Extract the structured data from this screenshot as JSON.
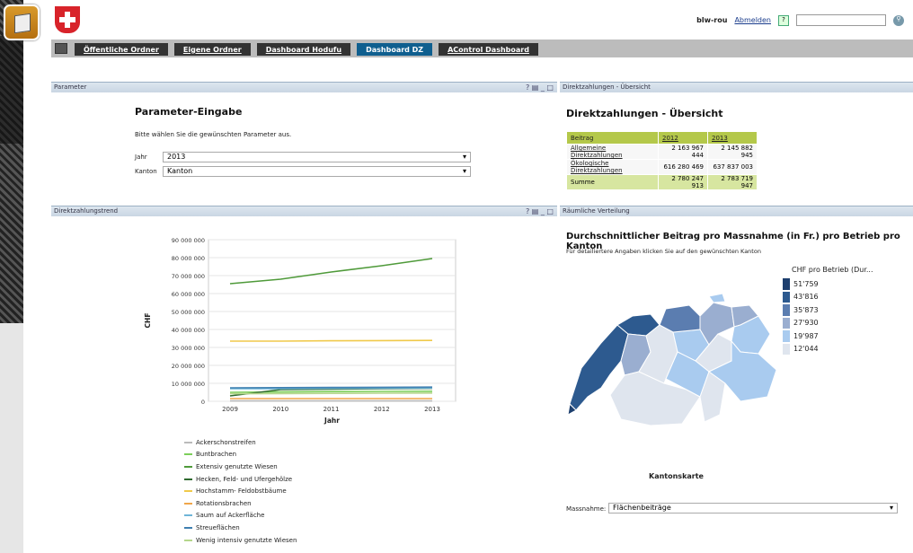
{
  "user": {
    "name": "blw-rou",
    "logout": "Abmelden"
  },
  "tabs": [
    {
      "label": "Öffentliche Ordner"
    },
    {
      "label": "Eigene Ordner"
    },
    {
      "label": "Dashboard Hodufu"
    },
    {
      "label": "Dashboard DZ",
      "active": true
    },
    {
      "label": "AControl Dashboard"
    }
  ],
  "parameter": {
    "header": "Parameter",
    "title": "Parameter-Eingabe",
    "instruction": "Bitte wählen Sie die gewünschten Parameter aus.",
    "jahr_label": "Jahr",
    "jahr_value": "2013",
    "kanton_label": "Kanton",
    "kanton_value": "Kanton"
  },
  "direkt": {
    "header": "Direktzahlungen - Übersicht",
    "title": "Direktzahlungen - Übersicht",
    "table": {
      "headers": [
        "Beitrag",
        "2012",
        "2013"
      ],
      "rows": [
        [
          "Allgemeine Direktzahlungen",
          "2 163 967 444",
          "2 145 882 945"
        ],
        [
          "Ökologische Direktzahlungen",
          "616 280 469",
          "637 837 003"
        ]
      ],
      "sum": [
        "Summe",
        "2 780 247 913",
        "2 783 719 947"
      ]
    }
  },
  "trend": {
    "header": "Direktzahlungstrend"
  },
  "chart_data": {
    "type": "line",
    "ylabel": "CHF",
    "xlabel": "Jahr",
    "x": [
      "2009",
      "2010",
      "2011",
      "2012",
      "2013"
    ],
    "yticks": [
      "90 000 000",
      "80 000 000",
      "70 000 000",
      "60 000 000",
      "50 000 000",
      "40 000 000",
      "30 000 000",
      "20 000 000",
      "10 000 000",
      "0"
    ],
    "ylim": [
      0,
      90000000
    ],
    "series": [
      {
        "name": "Ackerschonstreifen",
        "color": "#bbbbbb",
        "values": [
          200000,
          200000,
          200000,
          200000,
          200000
        ]
      },
      {
        "name": "Buntbrachen",
        "color": "#7ccf5a",
        "values": [
          5000000,
          5200000,
          5400000,
          5500000,
          5600000
        ]
      },
      {
        "name": "Extensiv genutzte Wiesen",
        "color": "#4f9a3a",
        "values": [
          65500000,
          68000000,
          72000000,
          75500000,
          79500000
        ]
      },
      {
        "name": "Hecken, Feld- und Ufergehölze",
        "color": "#2f6a2f",
        "values": [
          3000000,
          6500000,
          6800000,
          7000000,
          7200000
        ]
      },
      {
        "name": "Hochstamm- Feldobstbäume",
        "color": "#f0c94a",
        "values": [
          33500000,
          33500000,
          33700000,
          33800000,
          33900000
        ]
      },
      {
        "name": "Rotationsbrachen",
        "color": "#f0a64a",
        "values": [
          1500000,
          1500000,
          1500000,
          1500000,
          1500000
        ]
      },
      {
        "name": "Saum auf Ackerfläche",
        "color": "#6fb5d8",
        "values": [
          7000000,
          7000000,
          7200000,
          7300000,
          7400000
        ]
      },
      {
        "name": "Streueflächen",
        "color": "#3f7fb0",
        "values": [
          7500000,
          7600000,
          7700000,
          7800000,
          7900000
        ]
      },
      {
        "name": "Wenig intensiv genutzte Wiesen",
        "color": "#b5d68c",
        "values": [
          4200000,
          4300000,
          4400000,
          4500000,
          4600000
        ]
      }
    ]
  },
  "raum": {
    "header": "Räumliche Verteilung",
    "title": "Durchschnittlicher Beitrag pro Massnahme (in Fr.) pro Betrieb pro Kanton",
    "subtitle": "Für detailiertere Angaben klicken Sie auf den gewünschten Kanton",
    "legend_title": "CHF pro Betrieb (Dur...",
    "legend": [
      {
        "label": "51'759",
        "color": "#1d3f6e"
      },
      {
        "label": "43'816",
        "color": "#2d5a8f"
      },
      {
        "label": "35'873",
        "color": "#5b7db0"
      },
      {
        "label": "27'930",
        "color": "#9aaed0"
      },
      {
        "label": "19'987",
        "color": "#a9cbef"
      },
      {
        "label": "12'044",
        "color": "#dfe5ee"
      }
    ],
    "map_label": "Kantonskarte",
    "massnahme_label": "Massnahme:",
    "massnahme_value": "Flächenbeiträge"
  }
}
